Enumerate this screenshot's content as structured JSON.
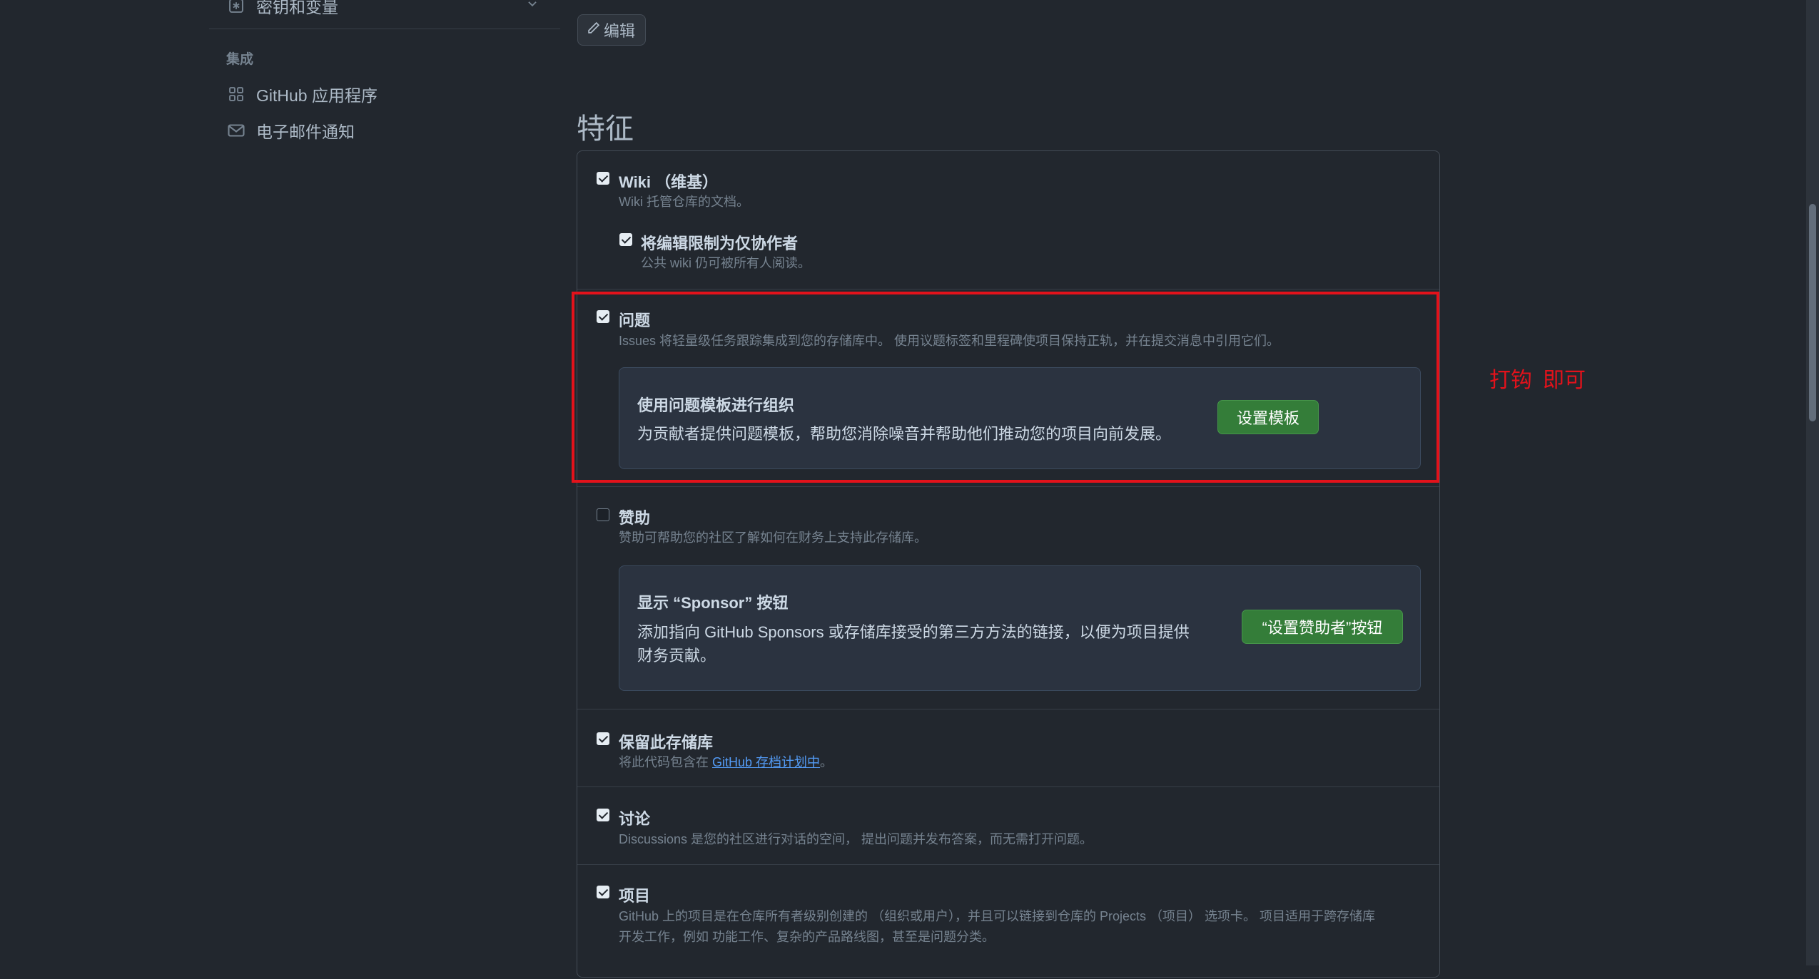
{
  "sidebar": {
    "top_item_label": "密钥和变量",
    "section_heading": "集成",
    "items": [
      {
        "label": "GitHub 应用程序",
        "icon": "apps-icon"
      },
      {
        "label": "电子邮件通知",
        "icon": "mail-icon"
      }
    ]
  },
  "main": {
    "edit_label": "编辑",
    "section_title": "特征",
    "features": {
      "wiki": {
        "title": "Wiki （维基）",
        "desc": "Wiki 托管仓库的文档。",
        "checked": true,
        "sub": {
          "title": "将编辑限制为仅协作者",
          "desc": "公共 wiki 仍可被所有人阅读。",
          "checked": true
        }
      },
      "issues": {
        "title": "问题",
        "desc": "Issues 将轻量级任务跟踪集成到您的存储库中。 使用议题标签和里程碑使项目保持正轨，并在提交消息中引用它们。",
        "checked": true,
        "callout": {
          "title": "使用问题模板进行组织",
          "desc": "为贡献者提供问题模板，帮助您消除噪音并帮助他们推动您的项目向前发展。",
          "button": "设置模板"
        }
      },
      "sponsorships": {
        "title": "赞助",
        "desc": "赞助可帮助您的社区了解如何在财务上支持此存储库。",
        "checked": false,
        "callout": {
          "title": "显示 “Sponsor” 按钮",
          "desc": "添加指向 GitHub Sponsors 或存储库接受的第三方方法的链接，以便为项目提供财务贡献。",
          "button": "“设置赞助者”按钮"
        }
      },
      "preserve": {
        "title": "保留此存储库",
        "desc_prefix": "将此代码包含在 ",
        "desc_link": "GitHub 存档计划中",
        "desc_suffix": "。",
        "checked": true
      },
      "discussions": {
        "title": "讨论",
        "desc": "Discussions 是您的社区进行对话的空间， 提出问题并发布答案，而无需打开问题。",
        "checked": true
      },
      "projects": {
        "title": "项目",
        "desc_line1": "GitHub 上的项目是在仓库所有者级别创建的 （组织或用户），并且可以链接到仓库的 Projects （项目） 选项卡。 项目适用于跨存储库",
        "desc_line2": "开发工作，例如 功能工作、复杂的产品路线图，甚至是问题分类。",
        "checked": true
      }
    }
  },
  "annotation": {
    "text": "打钩  即可",
    "color": "#e3121b"
  },
  "colors": {
    "background": "#22272e",
    "accent_green": "#347d39",
    "link": "#539bf5",
    "highlight_red": "#e3121b"
  }
}
